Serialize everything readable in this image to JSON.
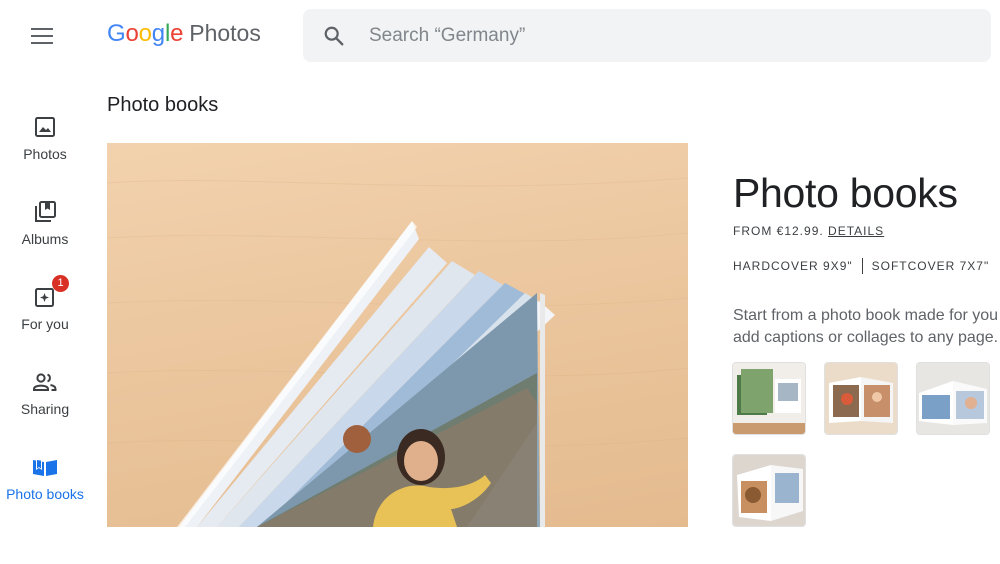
{
  "header": {
    "logo_google": [
      "G",
      "o",
      "o",
      "g",
      "l",
      "e"
    ],
    "logo_colors": [
      "#4285F4",
      "#EA4335",
      "#FBBC05",
      "#4285F4",
      "#34A853",
      "#EA4335"
    ],
    "logo_product": "Photos",
    "search_placeholder": "Search “Germany”"
  },
  "sidebar": {
    "items": [
      {
        "label": "Photos",
        "icon": "image-icon"
      },
      {
        "label": "Albums",
        "icon": "albums-icon"
      },
      {
        "label": "For you",
        "icon": "for-you-icon",
        "badge": "1"
      },
      {
        "label": "Sharing",
        "icon": "people-icon"
      },
      {
        "label": "Photo books",
        "icon": "book-icon",
        "active": true
      }
    ]
  },
  "main": {
    "page_title": "Photo books",
    "product": {
      "title": "Photo books",
      "price_text": "FROM €12.99.",
      "details_link": "DETAILS",
      "option_1": "HARDCOVER 9X9\"",
      "option_2": "SOFTCOVER 7X7\"",
      "desc_line_1": "Start from a photo book made for you",
      "desc_line_2": "add captions or collages to any page."
    }
  },
  "colors": {
    "accent": "#1a73e8",
    "badge": "#d93025"
  }
}
